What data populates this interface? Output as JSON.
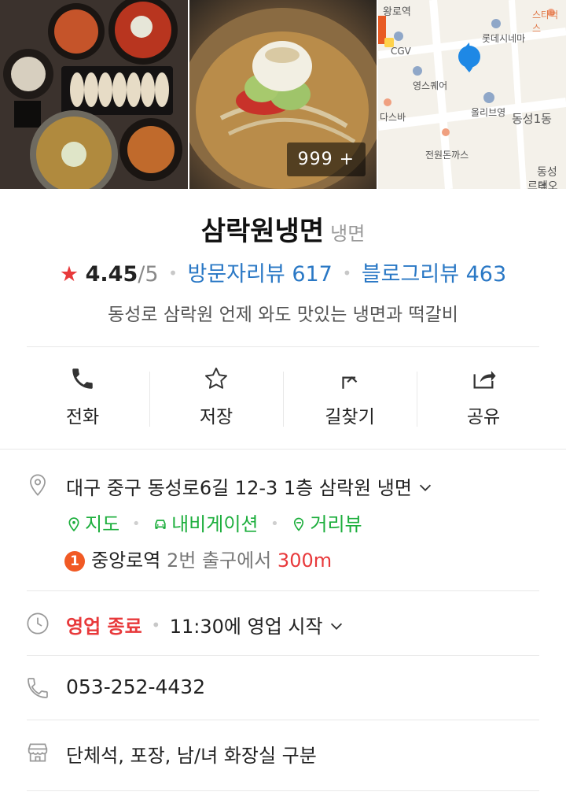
{
  "photos": {
    "count_label": "999 +",
    "map_labels": [
      "왕로역",
      "스타벅스",
      "롯데시네마",
      "CGV",
      "영스퀘어",
      "올리브영",
      "동성1동",
      "다스바",
      "전원돈까스",
      "동성로",
      "르데오"
    ],
    "map_pin_color": "#1e88e5"
  },
  "place": {
    "name": "삼락원냉면",
    "category": "냉면",
    "rating": "4.45",
    "rating_max": "/5",
    "visitor_reviews": "방문자리뷰 617",
    "blog_reviews": "블로그리뷰 463",
    "description": "동성로 삼락원 언제 와도 맛있는 냉면과 떡갈비"
  },
  "actions": [
    {
      "label": "전화",
      "icon": "phone-icon"
    },
    {
      "label": "저장",
      "icon": "star-outline-icon"
    },
    {
      "label": "길찾기",
      "icon": "directions-icon"
    },
    {
      "label": "공유",
      "icon": "share-icon"
    }
  ],
  "address": {
    "text": "대구 중구 동성로6길 12-3 1층 삼락원 냉면",
    "links": [
      "지도",
      "내비게이션",
      "거리뷰"
    ],
    "subway_line": "1",
    "subway_station": "중앙로역",
    "subway_exit": "2번 출구에서",
    "subway_distance": "300m"
  },
  "hours": {
    "status": "영업 종료",
    "next": "11:30에 영업 시작"
  },
  "phone": "053-252-4432",
  "facilities": "단체석, 포장, 남/녀 화장실 구분",
  "colors": {
    "accent_red": "#e8393b",
    "link_blue": "#2a78c5",
    "map_green": "#1cae3c",
    "subway_orange": "#f15a24"
  }
}
